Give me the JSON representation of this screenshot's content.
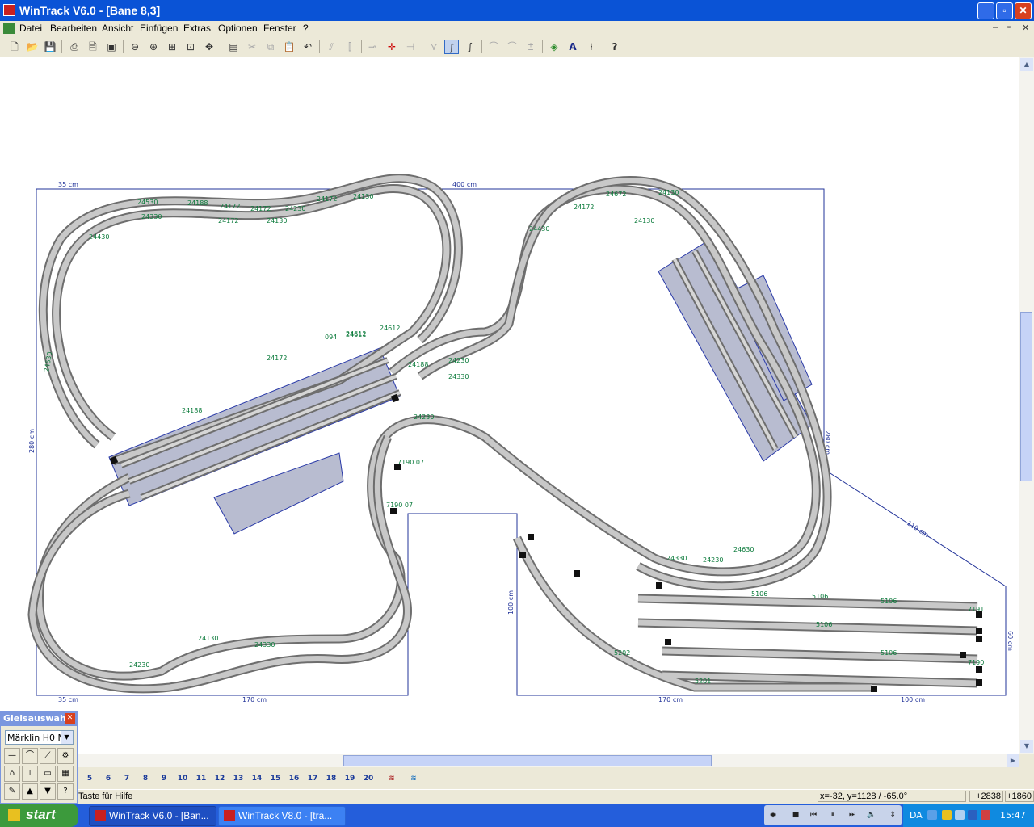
{
  "window": {
    "title": "WinTrack  V6.0 - [Bane 8,3]",
    "controls": {
      "minimize": "_",
      "maximize": "▫",
      "close": "✕"
    }
  },
  "menu": {
    "items": [
      "Datei",
      "Bearbeiten",
      "Ansicht",
      "Einfügen",
      "Extras",
      "Optionen",
      "Fenster",
      "?"
    ],
    "mdi_controls": [
      "–",
      "▫",
      "✕"
    ]
  },
  "toolbar": {
    "tools": [
      {
        "name": "new-icon",
        "glyph": "🗋"
      },
      {
        "name": "open-icon",
        "glyph": "📂"
      },
      {
        "name": "save-icon",
        "glyph": "💾"
      },
      {
        "name": "print-icon",
        "glyph": "⎙"
      },
      {
        "name": "print-preview-icon",
        "glyph": "🗎"
      },
      {
        "name": "image-export-icon",
        "glyph": "▣"
      },
      {
        "name": "zoom-out-icon",
        "glyph": "⊖"
      },
      {
        "name": "zoom-in-icon",
        "glyph": "⊕"
      },
      {
        "name": "zoom-area-icon",
        "glyph": "⊞"
      },
      {
        "name": "zoom-fit-icon",
        "glyph": "⊡"
      },
      {
        "name": "zoom-all-icon",
        "glyph": "✥"
      },
      {
        "name": "properties-icon",
        "glyph": "▤"
      },
      {
        "name": "cut-icon",
        "glyph": "✂"
      },
      {
        "name": "copy-icon",
        "glyph": "⧉"
      },
      {
        "name": "paste-icon",
        "glyph": "📋"
      },
      {
        "name": "undo-icon",
        "glyph": "↶"
      },
      {
        "name": "track-split-icon",
        "glyph": "⫽"
      },
      {
        "name": "track-join-icon",
        "glyph": "⫿"
      },
      {
        "name": "connect-icon",
        "glyph": "⊸"
      },
      {
        "name": "move-icon",
        "glyph": "✛"
      },
      {
        "name": "align-icon",
        "glyph": "⊣"
      },
      {
        "name": "switch-tool-icon",
        "glyph": "⋎"
      },
      {
        "name": "curve-tool-icon",
        "glyph": "∫"
      },
      {
        "name": "flex-track-icon",
        "glyph": "∫"
      },
      {
        "name": "flex-icon",
        "glyph": "⌒"
      },
      {
        "name": "flex-bend-icon",
        "glyph": "⌒"
      },
      {
        "name": "flex-join-icon",
        "glyph": "⩲"
      },
      {
        "name": "layers-icon",
        "glyph": "◈"
      },
      {
        "name": "text-icon",
        "glyph": "A"
      },
      {
        "name": "height-icon",
        "glyph": "⍿"
      },
      {
        "name": "help-icon",
        "glyph": "?"
      }
    ]
  },
  "layout": {
    "dimensions": [
      "35 cm",
      "400 cm",
      "280 cm",
      "280 cm",
      "110 cm",
      "100 cm",
      "60 cm",
      "35 cm",
      "170 cm",
      "170 cm",
      "100 cm"
    ],
    "track_labels": [
      "24530",
      "24188",
      "24172",
      "24172",
      "24230",
      "24172",
      "24130",
      "24330",
      "24130",
      "24172",
      "24612",
      "24612",
      "24172",
      "24130",
      "24330",
      "24230",
      "24188",
      "24230",
      "24330",
      "24630",
      "24430",
      "24230",
      "24130",
      "5106",
      "5106",
      "5106",
      "5106",
      "5106",
      "7191",
      "7190",
      "5201",
      "5202",
      "24172",
      "24672",
      "24130",
      "24330",
      "24430",
      "24230",
      "24630",
      "24188",
      "24611",
      "094",
      "7190 07",
      "7190 07"
    ]
  },
  "palette": {
    "title": "Gleisauswahl",
    "close": "✕",
    "selected": "Märklin H0 M-",
    "dropdown": "▼"
  },
  "trackbar": {
    "buttons": [
      "5",
      "6",
      "7",
      "8",
      "9",
      "10",
      "11",
      "12",
      "13",
      "14",
      "15",
      "16",
      "17",
      "18",
      "19",
      "20"
    ]
  },
  "status": {
    "hint": "Taste für Hilfe",
    "coords": "x=-32, y=1128 / -65.0°",
    "offset_x": "+2838",
    "offset_y": "+1860"
  },
  "scrollbars": {
    "up": "▲",
    "down": "▼",
    "left": "◀",
    "right": "▶"
  },
  "taskbar": {
    "start": "start",
    "tasks": [
      "WinTrack  V6.0 - [Ban...",
      "WinTrack  V8.0 - [tra..."
    ],
    "lang": "DA",
    "clock": "15:47"
  },
  "colors": {
    "titlebar": "#0a53d6",
    "track_rail": "#7a7a7a",
    "track_sleeper": "#c8c8c8",
    "label_green": "#0a7a3a",
    "dimension_blue": "#223399",
    "platform": "#b8bcd0"
  }
}
